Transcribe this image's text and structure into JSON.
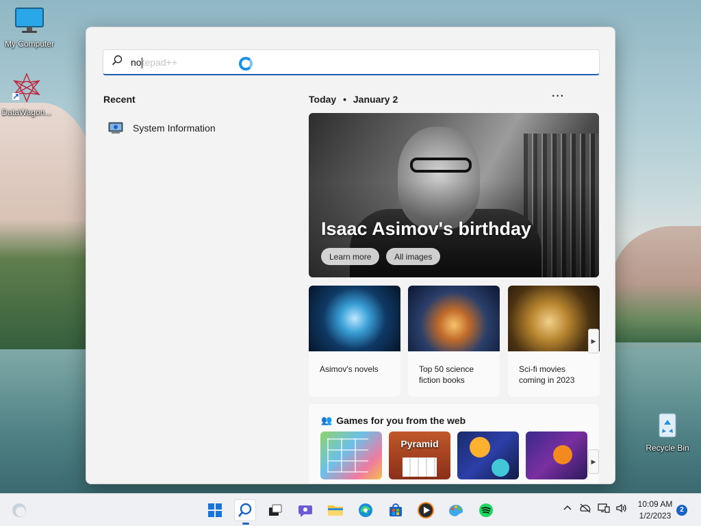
{
  "desktop": {
    "icons": [
      {
        "label": "My Computer",
        "icon": "monitor-icon"
      },
      {
        "label": "DataWagon...",
        "icon": "datawagon-icon"
      },
      {
        "label": "Recycle Bin",
        "icon": "recycle-bin-icon"
      }
    ]
  },
  "search": {
    "typed": "no",
    "suggestion": "tepad++",
    "icon": "search-icon"
  },
  "recent": {
    "title": "Recent",
    "items": [
      {
        "label": "System Information",
        "icon": "system-information-icon"
      }
    ]
  },
  "highlights": {
    "today_label": "Today",
    "bullet": "•",
    "date_label": "January 2",
    "more": "···",
    "hero": {
      "title": "Isaac Asimov's birthday",
      "buttons": [
        "Learn more",
        "All images"
      ]
    },
    "cards": [
      {
        "caption": "Asimov's novels"
      },
      {
        "caption": "Top 50 science fiction books"
      },
      {
        "caption": "Sci-fi movies coming in 2023"
      }
    ],
    "games": {
      "title": "Games for you from the web",
      "tiles": [
        {
          "name": "block-puzzle-game"
        },
        {
          "name": "pyramid-solitaire-game",
          "label": "Pyramid"
        },
        {
          "name": "stickman-game"
        },
        {
          "name": "basketball-game"
        }
      ]
    }
  },
  "taskbar": {
    "apps": [
      "start-icon",
      "search-icon",
      "task-view-icon",
      "teams-chat-icon",
      "file-explorer-icon",
      "edge-icon",
      "store-icon",
      "media-player-icon",
      "paint-icon",
      "spotify-icon"
    ],
    "tray": [
      "chevron-up-icon",
      "network-icon",
      "display-icon",
      "volume-icon"
    ],
    "time": "10:09 AM",
    "date": "1/2/2023",
    "notifications": "2"
  },
  "colors": {
    "accent": "#1a63c6",
    "panel_bg": "#f3f3f3",
    "taskbar_bg": "#eef0f3"
  }
}
